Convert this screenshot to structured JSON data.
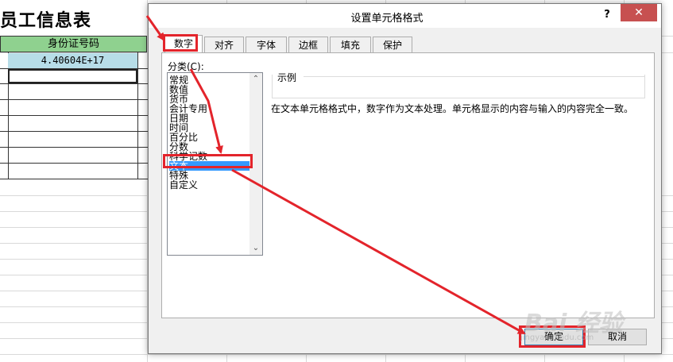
{
  "sheet": {
    "title": "员工信息表",
    "header_cell": "身份证号码",
    "value_cell": "4.40604E+17"
  },
  "dialog": {
    "title": "设置单元格格式",
    "help_label": "?",
    "close_label": "✕",
    "tabs": [
      {
        "label": "数字",
        "active": true
      },
      {
        "label": "对齐"
      },
      {
        "label": "字体"
      },
      {
        "label": "边框"
      },
      {
        "label": "填充"
      },
      {
        "label": "保护"
      }
    ],
    "category_label": "分类(C):",
    "categories": [
      "常规",
      "数值",
      "货币",
      "会计专用",
      "日期",
      "时间",
      "百分比",
      "分数",
      "科学记数",
      "文本",
      "特殊",
      "自定义"
    ],
    "selected_category": "文本",
    "sample_label": "示例",
    "description": "在文本单元格格式中，数字作为文本处理。单元格显示的内容与输入的内容完全一致。",
    "ok_label": "确定",
    "cancel_label": "取消"
  },
  "watermark": {
    "text": "Bai 经验",
    "sub": "jingyan.baidu.com"
  },
  "colors": {
    "annotation_red": "#e3242b",
    "selection_blue": "#3399ff",
    "close_red": "#c75050",
    "header_green": "#8fd18f",
    "value_blue": "#b7dde8"
  }
}
